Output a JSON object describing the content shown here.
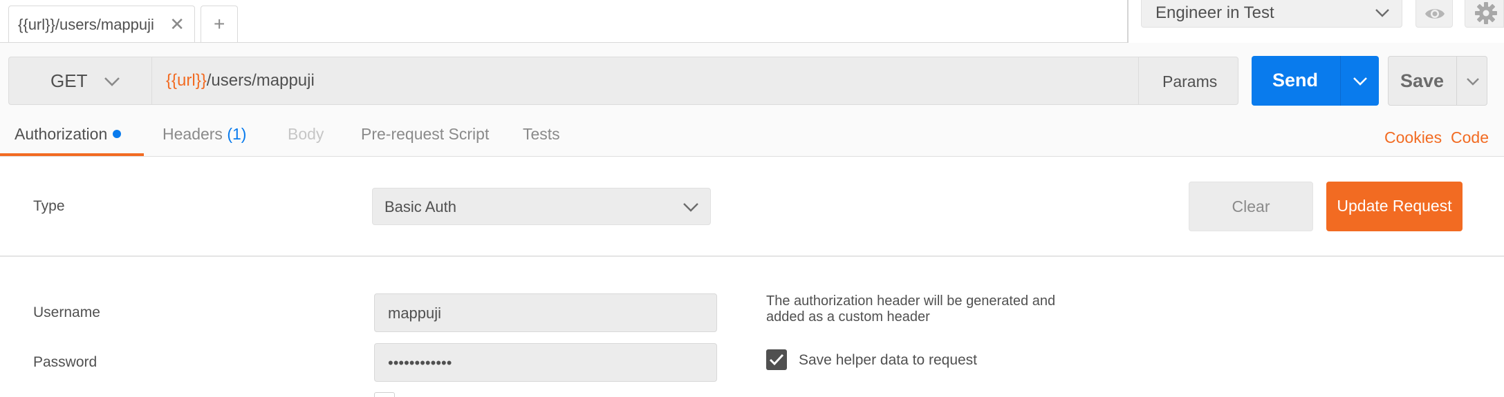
{
  "tabs": {
    "active_tab_label": "{{url}}/users/mappuji",
    "close_glyph": "✕",
    "new_tab_glyph": "+"
  },
  "header": {
    "environment": "Engineer in Test",
    "icons": [
      "eye-icon",
      "gear-icon"
    ]
  },
  "request": {
    "method": "GET",
    "url_variable": "{{url}}",
    "url_path": "/users/mappuji",
    "params_label": "Params",
    "send_label": "Send",
    "save_label": "Save"
  },
  "subtabs": {
    "authorization": "Authorization",
    "headers": "Headers",
    "headers_count": "(1)",
    "body": "Body",
    "prerequest": "Pre-request Script",
    "tests": "Tests",
    "cookies": "Cookies",
    "code": "Code"
  },
  "auth": {
    "type_label": "Type",
    "type_value": "Basic Auth",
    "clear_label": "Clear",
    "update_label": "Update Request",
    "username_label": "Username",
    "username_value": "mappuji",
    "password_label": "Password",
    "password_value": "••••••••••••",
    "helper_text": "The authorization header will be generated and added as a custom header",
    "save_helper_label": "Save helper data to request",
    "save_helper_checked": true
  },
  "colors": {
    "accent_orange": "#f26b22",
    "primary_blue": "#097bed"
  }
}
